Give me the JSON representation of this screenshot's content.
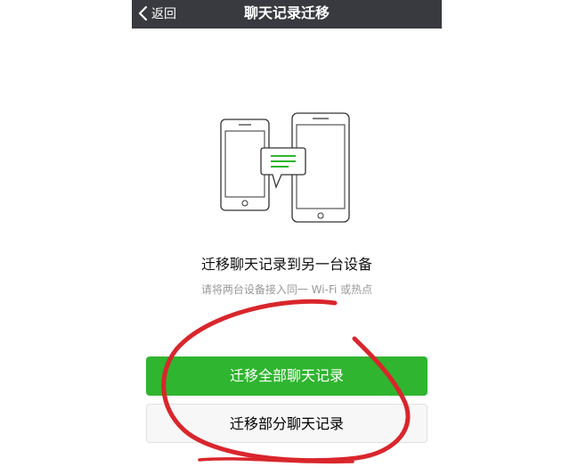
{
  "nav": {
    "back_label": "返回",
    "title": "聊天记录迁移"
  },
  "main": {
    "heading": "迁移聊天记录到另一台设备",
    "subtext": "请将两台设备接入同一 Wi-Fi 或热点",
    "primary_button_label": "迁移全部聊天记录",
    "secondary_button_label": "迁移部分聊天记录"
  },
  "colors": {
    "navbar": "#393a3f",
    "primary_button": "#2fb52f",
    "secondary_button": "#f7f7f7",
    "annotation": "#d9262c",
    "icon_green": "#2fb52f"
  },
  "icons": [
    "chevron-left-icon",
    "phone-icon",
    "tablet-icon",
    "chat-bubble-icon"
  ]
}
